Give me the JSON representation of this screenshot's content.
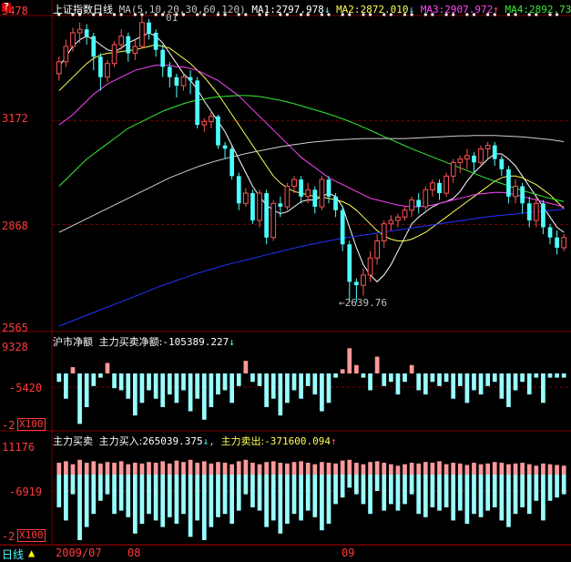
{
  "colors": {
    "up": "#ff5555",
    "down": "#4dffff",
    "ma1": "#ffffff",
    "ma2": "#ffff55",
    "ma3": "#ff44ff",
    "ma4": "#33ee33",
    "ma5": "#cfcfcf",
    "ma6": "#2233ff",
    "grid": "#7a0000",
    "axis": "#ff3b3b",
    "text": "#c0c0c0"
  },
  "help_label": "?",
  "main": {
    "title": "上证指数",
    "period": "日线",
    "ma_params": "MA(5,10,20,30,60,120)",
    "ma_items": [
      {
        "label": "MA1:",
        "value": "2797.978",
        "arrow": "↓",
        "color": "#ffffff"
      },
      {
        "label": "MA2:",
        "value": "2872.010",
        "arrow": "↓",
        "color": "#ffff55"
      },
      {
        "label": "MA3:",
        "value": "2907.972",
        "arrow": "↑",
        "color": "#ff44ff"
      },
      {
        "label": "MA4:",
        "value": "2892.73",
        "arrow": "",
        "color": "#33ee33"
      }
    ],
    "yaxis": [
      "3478",
      "3172",
      "2868",
      "2565"
    ],
    "hover_value": "01",
    "annotation": "←2639.76"
  },
  "panel1": {
    "title": "沪市净额",
    "indicator": "主力买卖净额:",
    "value": "-105389.227",
    "arrow": "↓",
    "yaxis": [
      "9328",
      "-5420",
      "-2"
    ],
    "unit": "X100"
  },
  "panel2": {
    "title": "主力买卖",
    "buy_label": "主力买入:",
    "buy_value": "265039.375",
    "buy_arrow": "↓",
    "sell_label": "主力卖出:",
    "sell_value": "-371600.094",
    "sell_arrow": "↑",
    "yaxis": [
      "11176",
      "-6919",
      "-2"
    ],
    "unit": "X100"
  },
  "tabs": {
    "period": "日线",
    "dates": [
      "2009/07",
      "08",
      "09"
    ]
  },
  "chart_data": {
    "type": "candlestick",
    "ylim": [
      2565,
      3478
    ],
    "candles": [
      [
        3310,
        3345,
        3290,
        3360
      ],
      [
        3345,
        3390,
        3330,
        3410
      ],
      [
        3390,
        3430,
        3375,
        3445
      ],
      [
        3430,
        3440,
        3400,
        3460
      ],
      [
        3440,
        3420,
        3395,
        3455
      ],
      [
        3420,
        3360,
        3320,
        3430
      ],
      [
        3360,
        3300,
        3260,
        3370
      ],
      [
        3300,
        3340,
        3285,
        3350
      ],
      [
        3340,
        3395,
        3330,
        3405
      ],
      [
        3395,
        3420,
        3380,
        3440
      ],
      [
        3420,
        3370,
        3345,
        3430
      ],
      [
        3370,
        3390,
        3350,
        3410
      ],
      [
        3390,
        3460,
        3385,
        3478
      ],
      [
        3460,
        3430,
        3410,
        3470
      ],
      [
        3430,
        3380,
        3360,
        3440
      ],
      [
        3380,
        3330,
        3300,
        3395
      ],
      [
        3330,
        3300,
        3270,
        3345
      ],
      [
        3300,
        3275,
        3240,
        3310
      ],
      [
        3275,
        3300,
        3260,
        3310
      ],
      [
        3300,
        3290,
        3250,
        3320
      ],
      [
        3290,
        3160,
        3150,
        3300
      ],
      [
        3160,
        3170,
        3140,
        3180
      ],
      [
        3170,
        3185,
        3150,
        3200
      ],
      [
        3185,
        3100,
        3090,
        3190
      ],
      [
        3100,
        3090,
        3060,
        3110
      ],
      [
        3090,
        3010,
        3000,
        3100
      ],
      [
        3010,
        2930,
        2910,
        3020
      ],
      [
        2930,
        2960,
        2920,
        2975
      ],
      [
        2960,
        2880,
        2870,
        2970
      ],
      [
        2880,
        2960,
        2860,
        2970
      ],
      [
        2960,
        2830,
        2810,
        2970
      ],
      [
        2830,
        2930,
        2820,
        2940
      ],
      [
        2930,
        2920,
        2890,
        2950
      ],
      [
        2920,
        2980,
        2910,
        2990
      ],
      [
        2980,
        3000,
        2960,
        3010
      ],
      [
        3000,
        2950,
        2930,
        3010
      ],
      [
        2950,
        2970,
        2930,
        2990
      ],
      [
        2970,
        2920,
        2900,
        2980
      ],
      [
        2920,
        3000,
        2910,
        3010
      ],
      [
        3000,
        2950,
        2930,
        3010
      ],
      [
        2950,
        2910,
        2890,
        2960
      ],
      [
        2910,
        2810,
        2790,
        2920
      ],
      [
        2810,
        2700,
        2640,
        2820
      ],
      [
        2700,
        2690,
        2640,
        2710
      ],
      [
        2690,
        2720,
        2660,
        2740
      ],
      [
        2720,
        2770,
        2700,
        2790
      ],
      [
        2770,
        2820,
        2750,
        2840
      ],
      [
        2820,
        2870,
        2800,
        2880
      ],
      [
        2870,
        2880,
        2850,
        2895
      ],
      [
        2880,
        2890,
        2860,
        2900
      ],
      [
        2890,
        2910,
        2880,
        2920
      ],
      [
        2910,
        2940,
        2890,
        2950
      ],
      [
        2940,
        2920,
        2900,
        2960
      ],
      [
        2920,
        2970,
        2910,
        2980
      ],
      [
        2970,
        2990,
        2950,
        3000
      ],
      [
        2990,
        2960,
        2940,
        3000
      ],
      [
        2960,
        3010,
        2950,
        3020
      ],
      [
        3010,
        3050,
        2990,
        3060
      ],
      [
        3050,
        3060,
        3020,
        3070
      ],
      [
        3060,
        3070,
        3030,
        3090
      ],
      [
        3070,
        3050,
        3020,
        3080
      ],
      [
        3050,
        3090,
        3040,
        3100
      ],
      [
        3090,
        3100,
        3060,
        3110
      ],
      [
        3100,
        3060,
        3040,
        3110
      ],
      [
        3060,
        3030,
        3010,
        3070
      ],
      [
        3030,
        2950,
        2930,
        3040
      ],
      [
        2950,
        2980,
        2930,
        3000
      ],
      [
        2980,
        2930,
        2900,
        2990
      ],
      [
        2930,
        2880,
        2860,
        2950
      ],
      [
        2880,
        2930,
        2860,
        2950
      ],
      [
        2930,
        2860,
        2840,
        2940
      ],
      [
        2860,
        2830,
        2810,
        2870
      ],
      [
        2830,
        2800,
        2780,
        2850
      ],
      [
        2800,
        2830,
        2790,
        2840
      ]
    ],
    "ma": {
      "MA1": [
        3330,
        3360,
        3390,
        3410,
        3420,
        3410,
        3395,
        3380,
        3375,
        3385,
        3400,
        3410,
        3420,
        3430,
        3420,
        3400,
        3370,
        3340,
        3310,
        3290,
        3265,
        3230,
        3200,
        3170,
        3140,
        3100,
        3060,
        3020,
        2980,
        2950,
        2925,
        2910,
        2900,
        2905,
        2920,
        2935,
        2940,
        2940,
        2950,
        2960,
        2950,
        2920,
        2860,
        2800,
        2750,
        2720,
        2700,
        2720,
        2750,
        2790,
        2830,
        2870,
        2890,
        2905,
        2920,
        2930,
        2935,
        2945,
        2965,
        2995,
        3020,
        3040,
        3060,
        3075,
        3075,
        3060,
        3040,
        3010,
        2980,
        2950,
        2920,
        2890,
        2860,
        2845
      ],
      "MA2": [
        3260,
        3280,
        3300,
        3320,
        3340,
        3355,
        3365,
        3370,
        3372,
        3375,
        3378,
        3380,
        3385,
        3390,
        3395,
        3390,
        3385,
        3370,
        3355,
        3340,
        3320,
        3300,
        3275,
        3250,
        3220,
        3190,
        3160,
        3130,
        3100,
        3070,
        3040,
        3010,
        2990,
        2975,
        2965,
        2960,
        2955,
        2950,
        2948,
        2945,
        2940,
        2935,
        2925,
        2910,
        2890,
        2870,
        2850,
        2835,
        2825,
        2820,
        2820,
        2825,
        2835,
        2845,
        2860,
        2875,
        2890,
        2905,
        2920,
        2935,
        2950,
        2965,
        2980,
        2995,
        3005,
        3010,
        3010,
        3005,
        2995,
        2985,
        2970,
        2955,
        2935,
        2915
      ],
      "MA3": [
        3160,
        3175,
        3190,
        3210,
        3230,
        3250,
        3265,
        3280,
        3290,
        3300,
        3310,
        3320,
        3325,
        3330,
        3335,
        3335,
        3335,
        3330,
        3330,
        3325,
        3320,
        3310,
        3300,
        3290,
        3275,
        3260,
        3245,
        3225,
        3205,
        3185,
        3165,
        3145,
        3125,
        3105,
        3085,
        3065,
        3050,
        3035,
        3020,
        3005,
        2995,
        2985,
        2975,
        2965,
        2955,
        2945,
        2940,
        2935,
        2930,
        2925,
        2922,
        2920,
        2920,
        2922,
        2925,
        2930,
        2935,
        2940,
        2945,
        2950,
        2955,
        2958,
        2960,
        2962,
        2962,
        2960,
        2955,
        2950,
        2945,
        2940,
        2935,
        2930,
        2925,
        2920
      ],
      "MA4": [
        2980,
        3000,
        3020,
        3040,
        3060,
        3075,
        3090,
        3105,
        3120,
        3135,
        3150,
        3160,
        3170,
        3180,
        3190,
        3200,
        3208,
        3215,
        3222,
        3228,
        3232,
        3236,
        3240,
        3242,
        3244,
        3245,
        3246,
        3246,
        3245,
        3243,
        3240,
        3236,
        3232,
        3227,
        3222,
        3216,
        3210,
        3204,
        3198,
        3192,
        3185,
        3178,
        3170,
        3162,
        3153,
        3144,
        3135,
        3126,
        3117,
        3108,
        3099,
        3090,
        3082,
        3074,
        3066,
        3058,
        3050,
        3042,
        3034,
        3026,
        3018,
        3010,
        3002,
        2995,
        2988,
        2981,
        2974,
        2968,
        2962,
        2956,
        2950,
        2945,
        2940,
        2935
      ],
      "MA5": [
        2845,
        2855,
        2865,
        2875,
        2885,
        2895,
        2905,
        2915,
        2925,
        2935,
        2945,
        2955,
        2965,
        2975,
        2985,
        2995,
        3005,
        3013,
        3021,
        3029,
        3037,
        3044,
        3050,
        3056,
        3061,
        3066,
        3071,
        3076,
        3080,
        3084,
        3088,
        3092,
        3096,
        3099,
        3102,
        3105,
        3108,
        3110,
        3112,
        3114,
        3116,
        3117,
        3118,
        3119,
        3120,
        3120,
        3120,
        3120,
        3120,
        3120,
        3120,
        3121,
        3122,
        3123,
        3124,
        3125,
        3126,
        3127,
        3128,
        3128,
        3129,
        3129,
        3129,
        3129,
        3128,
        3127,
        3126,
        3125,
        3123,
        3121,
        3119,
        3117,
        3114,
        3111
      ],
      "MA6": [
        2570,
        2578,
        2586,
        2594,
        2602,
        2610,
        2618,
        2626,
        2634,
        2642,
        2650,
        2658,
        2666,
        2674,
        2682,
        2690,
        2697,
        2704,
        2711,
        2718,
        2725,
        2731,
        2737,
        2743,
        2749,
        2754,
        2759,
        2764,
        2769,
        2774,
        2779,
        2784,
        2789,
        2794,
        2799,
        2804,
        2808,
        2812,
        2816,
        2820,
        2824,
        2828,
        2831,
        2834,
        2837,
        2840,
        2843,
        2846,
        2849,
        2852,
        2855,
        2858,
        2861,
        2864,
        2867,
        2870,
        2873,
        2876,
        2879,
        2882,
        2885,
        2888,
        2891,
        2893,
        2895,
        2897,
        2899,
        2901,
        2903,
        2905,
        2907,
        2909,
        2911,
        2913
      ]
    },
    "net_flow": [
      -20,
      -60,
      15,
      -120,
      -80,
      -30,
      -10,
      25,
      -35,
      -40,
      -60,
      -100,
      -70,
      -40,
      -60,
      -80,
      -50,
      -70,
      -40,
      -90,
      -60,
      -110,
      -80,
      -50,
      -40,
      -70,
      -30,
      30,
      -20,
      -30,
      -80,
      -60,
      -100,
      -70,
      -40,
      -60,
      -30,
      -50,
      -90,
      -70,
      -10,
      10,
      60,
      20,
      -10,
      -40,
      40,
      -30,
      -20,
      -50,
      -20,
      20,
      -40,
      -50,
      -20,
      -30,
      -20,
      -60,
      -30,
      -70,
      -40,
      -50,
      -30,
      -20,
      -60,
      -80,
      -40,
      -20,
      -50,
      -10,
      -70,
      -10,
      -10,
      -10
    ],
    "buy": [
      80,
      90,
      70,
      100,
      80,
      90,
      75,
      85,
      80,
      90,
      70,
      80,
      75,
      85,
      80,
      90,
      75,
      95,
      85,
      100,
      80,
      90,
      75,
      85,
      80,
      70,
      90,
      100,
      80,
      70,
      85,
      90,
      80,
      75,
      85,
      90,
      80,
      70,
      85,
      80,
      75,
      95,
      100,
      80,
      70,
      85,
      90,
      80,
      70,
      60,
      70,
      80,
      75,
      85,
      80,
      90,
      70,
      80,
      75,
      65,
      80,
      70,
      75,
      85,
      80,
      70,
      75,
      80,
      70,
      60,
      75,
      70,
      65,
      60
    ],
    "sell": [
      -100,
      -140,
      -60,
      -200,
      -160,
      -120,
      -80,
      -60,
      -120,
      -110,
      -130,
      -180,
      -150,
      -120,
      -140,
      -160,
      -130,
      -150,
      -120,
      -190,
      -140,
      -200,
      -160,
      -130,
      -120,
      -150,
      -110,
      -60,
      -100,
      -110,
      -160,
      -140,
      -180,
      -150,
      -120,
      -140,
      -110,
      -130,
      -170,
      -150,
      -90,
      -70,
      -40,
      -60,
      -90,
      -120,
      -50,
      -110,
      -90,
      -110,
      -90,
      -60,
      -120,
      -130,
      -100,
      -110,
      -100,
      -140,
      -110,
      -150,
      -120,
      -130,
      -110,
      -100,
      -140,
      -160,
      -120,
      -100,
      -120,
      -80,
      -140,
      -80,
      -70,
      -60
    ]
  }
}
